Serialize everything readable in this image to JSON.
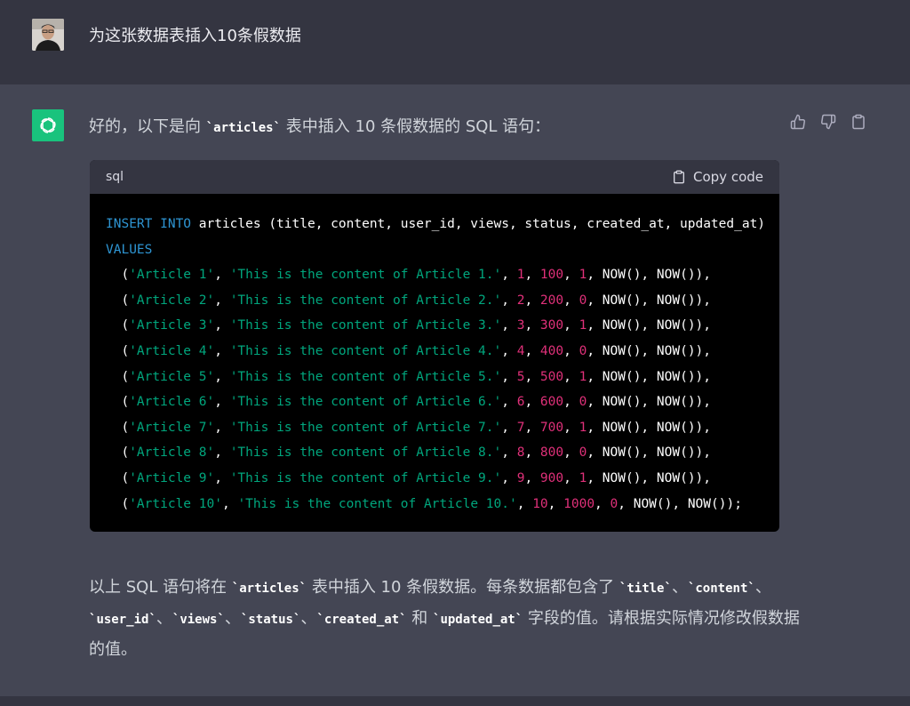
{
  "user_message": "为这张数据表插入10条假数据",
  "reply": {
    "intro_prefix": "好的，以下是向 ",
    "intro_table": "articles",
    "intro_suffix": " 表中插入 10 条假数据的 SQL 语句："
  },
  "code_block": {
    "language": "sql",
    "copy_label": "Copy code",
    "header_line": {
      "kw": "INSERT INTO",
      "rest": " articles (title, content, user_id, views, status, created_at, updated_at)"
    },
    "values_kw": "VALUES",
    "rows": [
      {
        "title": "'Article 1'",
        "content": "'This is the content of Article 1.'",
        "user_id": "1",
        "views": "100",
        "status": "1",
        "end": ","
      },
      {
        "title": "'Article 2'",
        "content": "'This is the content of Article 2.'",
        "user_id": "2",
        "views": "200",
        "status": "0",
        "end": ","
      },
      {
        "title": "'Article 3'",
        "content": "'This is the content of Article 3.'",
        "user_id": "3",
        "views": "300",
        "status": "1",
        "end": ","
      },
      {
        "title": "'Article 4'",
        "content": "'This is the content of Article 4.'",
        "user_id": "4",
        "views": "400",
        "status": "0",
        "end": ","
      },
      {
        "title": "'Article 5'",
        "content": "'This is the content of Article 5.'",
        "user_id": "5",
        "views": "500",
        "status": "1",
        "end": ","
      },
      {
        "title": "'Article 6'",
        "content": "'This is the content of Article 6.'",
        "user_id": "6",
        "views": "600",
        "status": "0",
        "end": ","
      },
      {
        "title": "'Article 7'",
        "content": "'This is the content of Article 7.'",
        "user_id": "7",
        "views": "700",
        "status": "1",
        "end": ","
      },
      {
        "title": "'Article 8'",
        "content": "'This is the content of Article 8.'",
        "user_id": "8",
        "views": "800",
        "status": "0",
        "end": ","
      },
      {
        "title": "'Article 9'",
        "content": "'This is the content of Article 9.'",
        "user_id": "9",
        "views": "900",
        "status": "1",
        "end": ","
      },
      {
        "title": "'Article 10'",
        "content": "'This is the content of Article 10.'",
        "user_id": "10",
        "views": "1000",
        "status": "0",
        "end": ";"
      }
    ],
    "now_fn": "NOW()"
  },
  "summary": {
    "t1": "以上 SQL 语句将在 ",
    "c1": "articles",
    "t2": " 表中插入 10 条假数据。每条数据都包含了 ",
    "c2": "title",
    "sep": "、",
    "c3": "content",
    "c4": "user_id",
    "c5": "views",
    "c6": "status",
    "c7": "created_at",
    "and": " 和 ",
    "c8": "updated_at",
    "t3": " 字段的值。请根据实际情况修改假数据的值。"
  },
  "colors": {
    "keyword": "#2e95d3",
    "string": "#00a67d",
    "number": "#df3079",
    "gpt_avatar": "#19c37d"
  },
  "icons": [
    "openai-logo-icon",
    "thumbs-up-icon",
    "thumbs-down-icon",
    "clipboard-icon"
  ]
}
